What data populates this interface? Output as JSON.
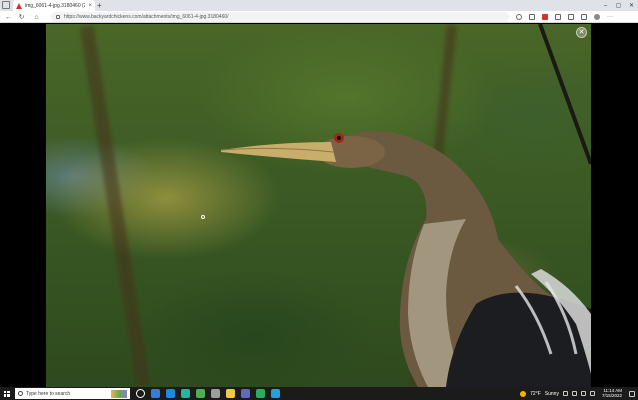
{
  "browser": {
    "tab": {
      "title": "img_6061-4-jpg.3180460 (2000×...",
      "close_glyph": "×",
      "favicon": "warning-triangle-icon",
      "favicon_color": "#d93025"
    },
    "new_tab_glyph": "+",
    "window_controls": {
      "minimize": "–",
      "maximize": "▢",
      "close": "✕"
    },
    "nav": {
      "back": "←",
      "reload": "↻",
      "home": "⌂"
    },
    "url": "https://www.backyardchickens.com/attachments/img_6061-4-jpg.3180460/",
    "more_menu_glyph": "···"
  },
  "viewer": {
    "close_glyph": "✕",
    "subject": "anhinga"
  },
  "taskbar": {
    "search_placeholder": "Type here to search",
    "weather": {
      "temp": "72°F",
      "condition": "Sunny"
    },
    "clock": {
      "time": "11:14 AM",
      "date": "7/15/2022"
    },
    "app_colors": [
      "#ffffff",
      "#3a7bd5",
      "#1e88e5",
      "#2bb3a0",
      "#4caf50",
      "#9e9e9e",
      "#f2c94c",
      "#5c6bc0",
      "#27ae60",
      "#2d9cdb"
    ]
  }
}
